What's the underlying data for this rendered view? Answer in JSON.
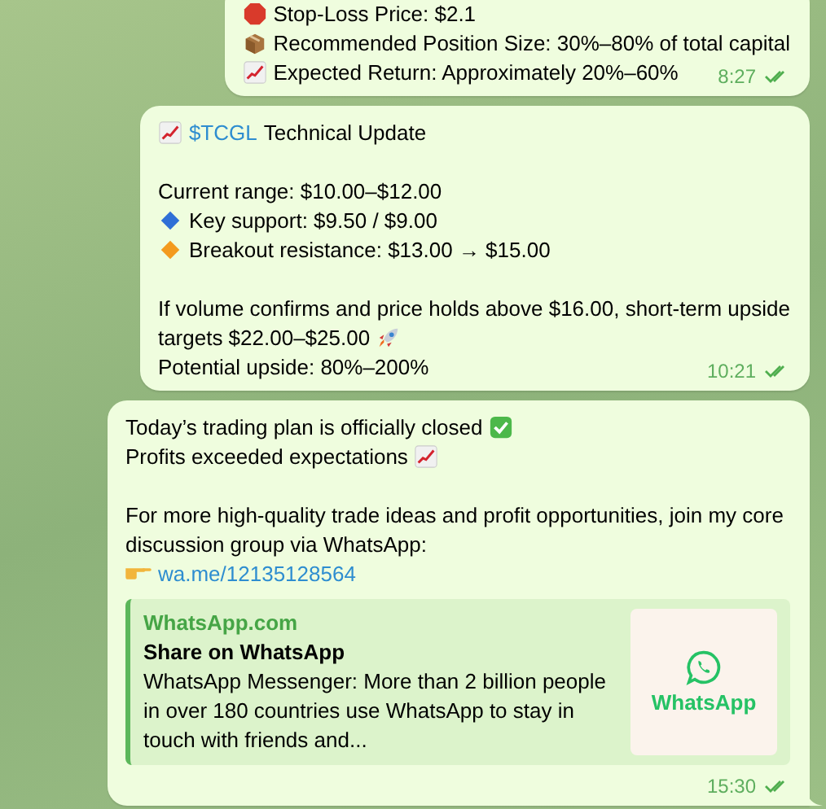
{
  "messages": [
    {
      "time": "8:27",
      "read": true,
      "paragraphs": [
        {
          "parts": [
            {
              "kind": "stop-emoji"
            },
            {
              "kind": "text",
              "text": "Stop-Loss Price: $2.1"
            }
          ]
        },
        {
          "parts": [
            {
              "kind": "box-emoji"
            },
            {
              "kind": "text",
              "text": "Recommended Position Size: 30%–80% of total capital"
            }
          ]
        },
        {
          "parts": [
            {
              "kind": "chart-emoji"
            },
            {
              "kind": "text",
              "text": "Expected Return: Approximately 20%–60%"
            }
          ]
        }
      ]
    },
    {
      "time": "10:21",
      "read": true,
      "paragraphs": [
        {
          "parts": [
            {
              "kind": "chart-emoji"
            },
            {
              "kind": "link",
              "text": "$TCGL"
            },
            {
              "kind": "text",
              "text": "Technical Update"
            }
          ]
        },
        {
          "kind": "spacer"
        },
        {
          "parts": [
            {
              "kind": "text",
              "text": "Current range: $10.00–$12.00"
            }
          ]
        },
        {
          "parts": [
            {
              "kind": "blue-diamond-emoji"
            },
            {
              "kind": "text",
              "text": "Key support: $9.50 / $9.00"
            }
          ]
        },
        {
          "parts": [
            {
              "kind": "orange-diamond-emoji"
            },
            {
              "kind": "text",
              "text": "Breakout resistance: $13.00 → $15.00"
            }
          ]
        },
        {
          "kind": "spacer"
        },
        {
          "parts": [
            {
              "kind": "text",
              "text": "If volume confirms and price holds above $16.00, short-term upside"
            }
          ]
        },
        {
          "parts": [
            {
              "kind": "text",
              "text": "targets $22.00–$25.00"
            },
            {
              "kind": "rocket-emoji"
            }
          ]
        },
        {
          "parts": [
            {
              "kind": "text",
              "text": "Potential upside: 80%–200%"
            }
          ]
        }
      ]
    },
    {
      "time": "15:30",
      "read": true,
      "paragraphs": [
        {
          "parts": [
            {
              "kind": "text",
              "text": "Today’s trading plan is officially closed"
            },
            {
              "kind": "check-emoji"
            }
          ]
        },
        {
          "parts": [
            {
              "kind": "text",
              "text": "Profits exceeded expectations"
            },
            {
              "kind": "chart-emoji"
            }
          ]
        },
        {
          "kind": "spacer"
        },
        {
          "parts": [
            {
              "kind": "text",
              "text": "For more high-quality trade ideas and profit opportunities, join my core discussion group via WhatsApp:"
            }
          ]
        },
        {
          "parts": [
            {
              "kind": "hand-emoji"
            },
            {
              "kind": "link",
              "text": "wa.me/12135128564"
            }
          ]
        }
      ],
      "preview": {
        "site": "WhatsApp.com",
        "title": "Share on WhatsApp",
        "description": "WhatsApp Messenger: More than 2 billion people in over 180 countries use WhatsApp to stay in touch with friends and...",
        "thumbnail_text": "WhatsApp"
      }
    }
  ]
}
